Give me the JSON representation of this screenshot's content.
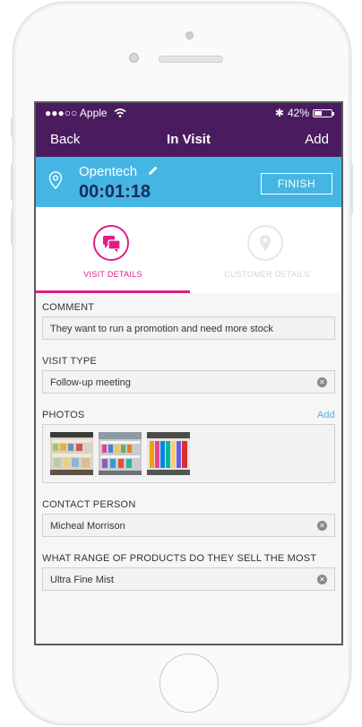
{
  "status": {
    "carrier": "●●●○○ Apple",
    "bluetooth": "✱",
    "battery": "42%",
    "battery_fraction": 0.42
  },
  "nav": {
    "back": "Back",
    "title": "In Visit",
    "add": "Add"
  },
  "visit": {
    "company": "Opentech",
    "timer": "00:01:18",
    "finish": "FINISH"
  },
  "tabs": [
    {
      "label": "VISIT DETAILS",
      "active": true
    },
    {
      "label": "CUSTOMER DETAILS",
      "active": false
    }
  ],
  "form": {
    "comment_label": "COMMENT",
    "comment_value": "They want to run a promotion and need more stock",
    "visit_type_label": "VISIT TYPE",
    "visit_type_value": "Follow-up meeting",
    "photos_label": "PHOTOS",
    "photos_add": "Add",
    "contact_label": "CONTACT PERSON",
    "contact_value": "Micheal Morrison",
    "range_label": "WHAT RANGE OF PRODUCTS DO THEY SELL THE MOST",
    "range_value": "Ultra Fine Mist"
  },
  "colors": {
    "nav_bg": "#4a1c5f",
    "visit_bg": "#45b6e3",
    "accent": "#e01d86",
    "timer": "#1b2a5c"
  }
}
